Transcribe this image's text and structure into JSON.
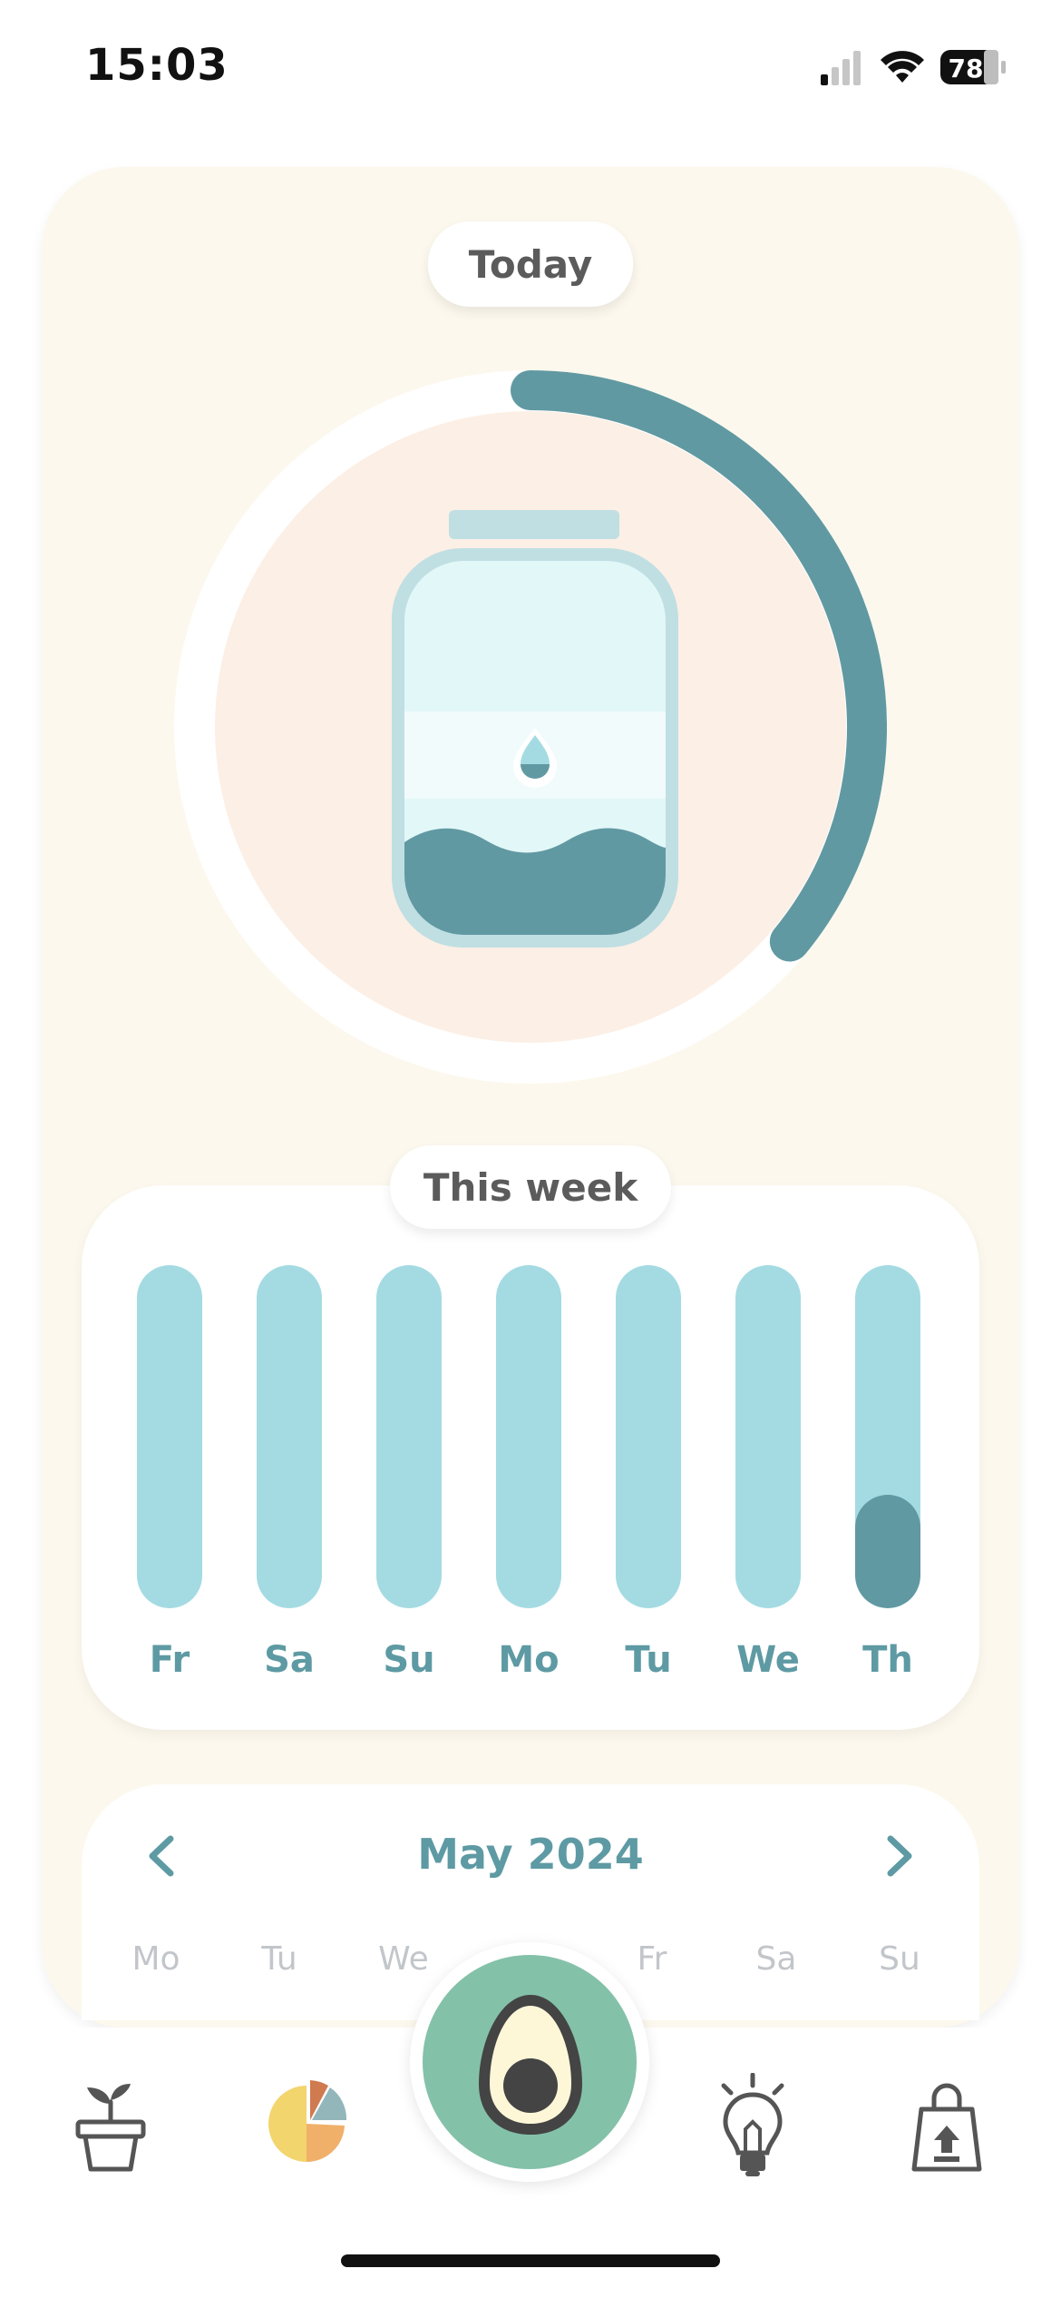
{
  "status_bar": {
    "time": "15:03",
    "battery": "78",
    "icons": [
      "cellular-signal-icon",
      "wifi-icon",
      "battery-icon"
    ]
  },
  "today": {
    "label": "Today",
    "progress": 0.36
  },
  "this_week": {
    "label": "This week",
    "days": [
      {
        "label": "Fr",
        "fill": 0
      },
      {
        "label": "Sa",
        "fill": 0
      },
      {
        "label": "Su",
        "fill": 0
      },
      {
        "label": "Mo",
        "fill": 0
      },
      {
        "label": "Tu",
        "fill": 0
      },
      {
        "label": "We",
        "fill": 0
      },
      {
        "label": "Th",
        "fill": 0.33
      }
    ]
  },
  "calendar": {
    "month_title": "May 2024",
    "weekdays": [
      "Mo",
      "Tu",
      "We",
      "Fr",
      "Sa",
      "Su"
    ]
  },
  "tab_bar": {
    "tabs": [
      "plant-pot-icon",
      "pie-chart-icon",
      "avocado-icon",
      "lightbulb-icon",
      "shopping-bag-icon"
    ]
  },
  "colors": {
    "accent": "#6199a2",
    "light_accent": "#a4dbe2",
    "card_bg": "#fcf8ed",
    "ring_inner": "#fcefe5",
    "center_button": "#84c1a9"
  }
}
